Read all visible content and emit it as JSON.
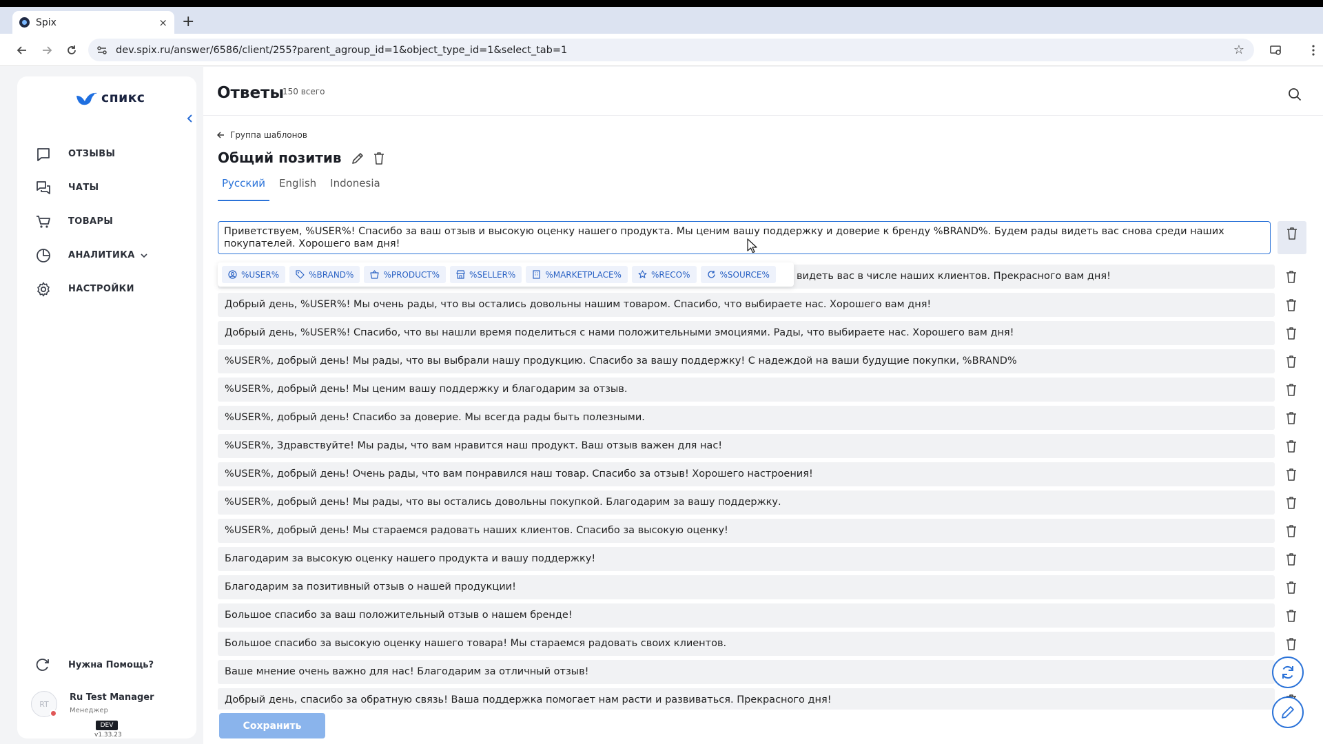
{
  "browser": {
    "tab_title": "Spix",
    "tab_close": "×",
    "new_tab": "+",
    "url": "dev.spix.ru/answer/6586/client/255?parent_agroup_id=1&object_type_id=1&select_tab=1"
  },
  "sidebar": {
    "logo_text": "спикс",
    "items": [
      {
        "label": "ОТЗЫВЫ",
        "icon": "reviews-icon"
      },
      {
        "label": "ЧАТЫ",
        "icon": "chats-icon"
      },
      {
        "label": "ТОВАРЫ",
        "icon": "cart-icon"
      },
      {
        "label": "АНАЛИТИКА",
        "icon": "analytics-icon"
      },
      {
        "label": "НАСТРОЙКИ",
        "icon": "gear-icon"
      }
    ],
    "help_label": "Нужна Помощь?",
    "user": {
      "initials": "RT",
      "name": "Ru Test Manager",
      "role": "Менеджер"
    },
    "env_badge": "DEV",
    "version": "v1.33.23"
  },
  "header": {
    "title": "Ответы",
    "count": "150 всего"
  },
  "group": {
    "back_label": "Группа шаблонов",
    "title": "Общий позитив"
  },
  "tabs": [
    {
      "label": "Русский",
      "active": true
    },
    {
      "label": "English",
      "active": false
    },
    {
      "label": "Indonesia",
      "active": false
    }
  ],
  "editing_text": "Приветствуем, %USER%! Спасибо за ваш отзыв и высокую оценку нашего продукта. Мы ценим вашу поддержку и доверие к бренду %BRAND%. Будем рады видеть вас снова среди наших покупателей. Хорошего вам дня!",
  "tags": [
    {
      "label": "%USER%",
      "icon": "user-circle-icon"
    },
    {
      "label": "%BRAND%",
      "icon": "tag-icon"
    },
    {
      "label": "%PRODUCT%",
      "icon": "basket-icon"
    },
    {
      "label": "%SELLER%",
      "icon": "shop-icon"
    },
    {
      "label": "%MARKETPLACE%",
      "icon": "building-icon"
    },
    {
      "label": "%RECO%",
      "icon": "star-icon"
    },
    {
      "label": "%SOURCE%",
      "icon": "refresh-icon"
    }
  ],
  "answers": [
    "видеть вас в числе наших клиентов. Прекрасного вам дня!",
    "Добрый день, %USER%! Мы очень рады, что вы остались довольны нашим товаром. Спасибо, что выбираете нас. Хорошего вам дня!",
    "Добрый день, %USER%! Спасибо, что вы нашли время поделиться с нами положительными эмоциями. Рады, что выбираете нас. Хорошего вам дня!",
    "%USER%, добрый день! Мы рады, что вы выбрали нашу продукцию. Спасибо за вашу поддержку! С надеждой на ваши будущие покупки, %BRAND%",
    "%USER%, добрый день! Мы ценим вашу поддержку и благодарим за отзыв.",
    "%USER%, добрый день! Спасибо за доверие. Мы всегда рады быть полезными.",
    "%USER%, Здравствуйте! Мы рады, что вам нравится наш продукт. Ваш отзыв важен для нас!",
    "%USER%, добрый день! Очень рады, что вам понравился наш товар. Спасибо за отзыв! Хорошего настроения!",
    "%USER%, добрый день! Мы рады, что вы остались довольны покупкой. Благодарим за вашу поддержку.",
    "%USER%, добрый день! Мы стараемся радовать наших клиентов. Спасибо за высокую оценку!",
    "Благодарим за высокую оценку нашего продукта и вашу поддержку!",
    "Благодарим за позитивный отзыв о нашей продукции!",
    "Большое спасибо за ваш положительный отзыв о нашем бренде!",
    "Большое спасибо за высокую оценку нашего товара! Мы стараемся радовать своих клиентов.",
    "Ваше мнение очень важно для нас! Благодарим за отличный отзыв!",
    "Добрый день, спасибо за обратную связь! Ваша поддержка помогает нам расти и развиваться. Прекрасного дня!"
  ],
  "save_label": "Сохранить",
  "colors": {
    "accent": "#2a72d8",
    "save_button": "#8ab4ec",
    "row_bg": "#f1f2f4"
  }
}
